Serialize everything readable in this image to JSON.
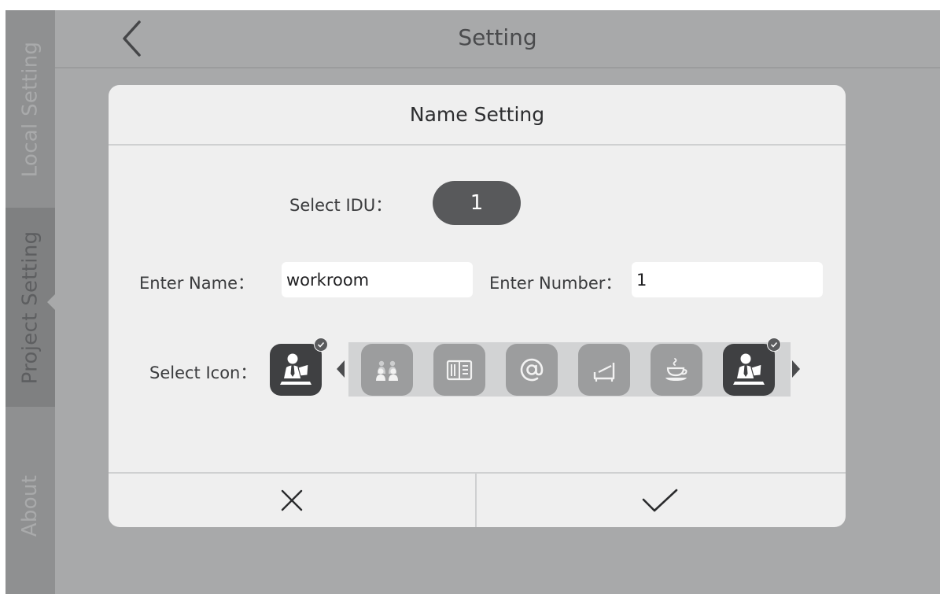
{
  "header": {
    "title": "Setting",
    "back_icon": "chevron-left-icon"
  },
  "sidebar": {
    "items": [
      {
        "label": "Local Setting",
        "active": false
      },
      {
        "label": "Project Setting",
        "active": true
      },
      {
        "label": "About",
        "active": false
      }
    ]
  },
  "dialog": {
    "title": "Name Setting",
    "select_idu": {
      "label": "Select IDU：",
      "value": "1"
    },
    "enter_name": {
      "label": "Enter Name：",
      "value": "workroom"
    },
    "enter_number": {
      "label": "Enter Number：",
      "value": "1"
    },
    "select_icon": {
      "label": "Select Icon：",
      "current_icon": "office-worker-icon",
      "options": [
        {
          "icon": "meeting-group-icon",
          "selected": false
        },
        {
          "icon": "dining-menu-icon",
          "selected": false
        },
        {
          "icon": "at-sign-icon",
          "selected": false
        },
        {
          "icon": "lounge-chair-icon",
          "selected": false
        },
        {
          "icon": "coffee-cup-icon",
          "selected": false
        },
        {
          "icon": "office-worker-icon",
          "selected": true
        }
      ]
    },
    "cancel_icon": "close-icon",
    "confirm_icon": "checkmark-icon"
  },
  "colors": {
    "screen_bg": "#a8a9aa",
    "sidebar_bg": "#8f9091",
    "dialog_bg": "#efefef",
    "accent_dark": "#58595b",
    "icon_inactive": "#9c9d9e"
  }
}
